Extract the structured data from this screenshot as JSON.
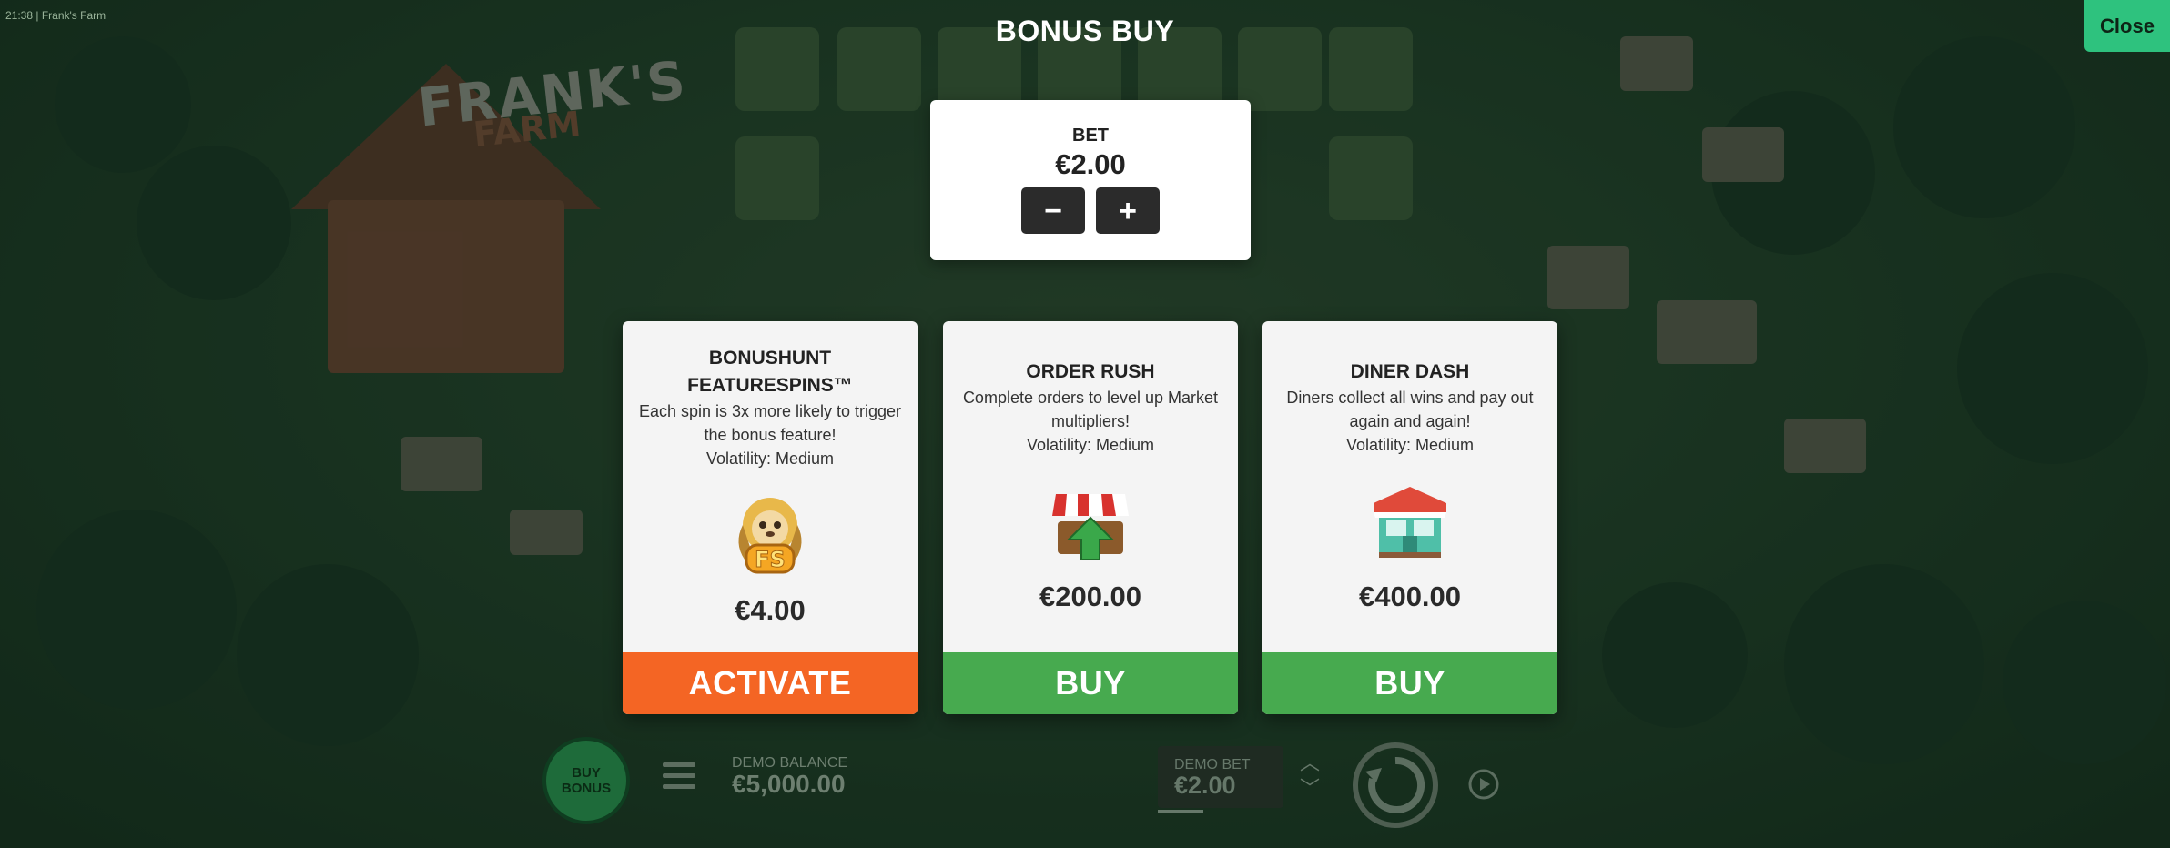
{
  "meta": {
    "time": "21:38",
    "separator": "|",
    "game_name": "Frank's Farm"
  },
  "background": {
    "logo_line1": "FRANK'S",
    "logo_line2": "FARM"
  },
  "modal": {
    "title": "BONUS BUY",
    "close_label": "Close",
    "bet": {
      "label": "BET",
      "value": "€2.00",
      "decrease": "−",
      "increase": "+"
    },
    "offers": [
      {
        "name": "BONUSHUNT FEATURESPINS™",
        "description": "Each spin is 3x more likely to trigger the bonus feature!",
        "volatility": "Volatility: Medium",
        "icon": "sloth-fs-icon",
        "price": "€4.00",
        "button": "ACTIVATE",
        "button_color": "#f46524"
      },
      {
        "name": "ORDER RUSH",
        "description": "Complete orders to level up Market multipliers!",
        "volatility": "Volatility: Medium",
        "icon": "market-stall-arrow-icon",
        "price": "€200.00",
        "button": "BUY",
        "button_color": "#47aa4f"
      },
      {
        "name": "DINER DASH",
        "description": "Diners collect all wins and pay out again and again!",
        "volatility": "Volatility: Medium",
        "icon": "diner-building-icon",
        "price": "€400.00",
        "button": "BUY",
        "button_color": "#47aa4f"
      }
    ]
  },
  "bottom_bar": {
    "buy_bonus_label": "BUY BONUS",
    "balance_label": "DEMO BALANCE",
    "balance_value": "€5,000.00",
    "bet_label": "DEMO BET",
    "bet_value": "€2.00"
  },
  "colors": {
    "accent_green": "#2ec27e",
    "activate_orange": "#f46524",
    "buy_green": "#47aa4f"
  }
}
